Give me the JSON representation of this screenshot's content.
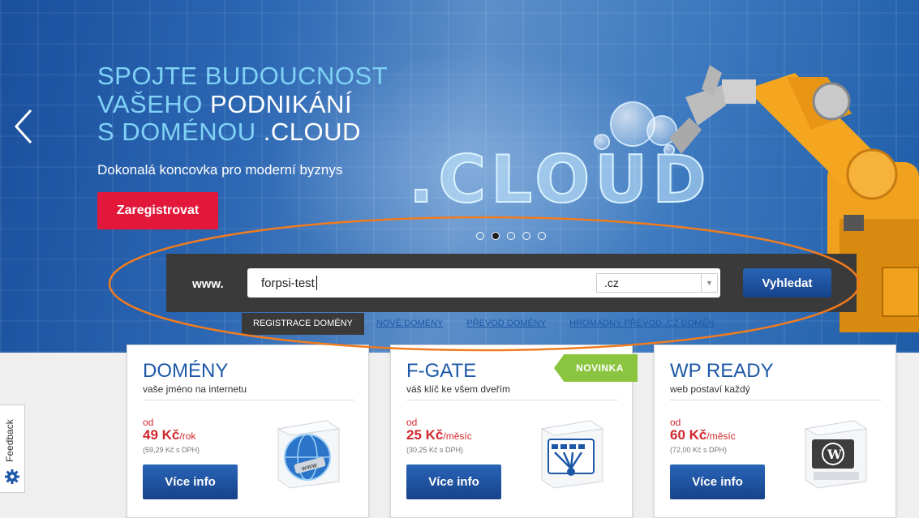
{
  "hero": {
    "headline_line1": "SPOJTE BUDOUCNOST",
    "headline_line2_a": "VAŠEHO ",
    "headline_line2_b": "PODNIKÁNÍ",
    "headline_line3_a": "S DOMÉNOU ",
    "headline_line3_b": ".CLOUD",
    "subtitle": "Dokonalá koncovka pro moderní byznys",
    "register_label": "Zaregistrovat",
    "logo_text": ".CLOUD",
    "slides_total": 5,
    "slide_active": 2
  },
  "search": {
    "prefix": "www.",
    "value": "forpsi-test",
    "tld_selected": ".cz",
    "submit_label": "Vyhledat"
  },
  "tabs": [
    {
      "label": "REGISTRACE DOMÉNY",
      "active": true
    },
    {
      "label": "NOVÉ DOMÉNY",
      "active": false
    },
    {
      "label": "PŘEVOD DOMÉNY",
      "active": false
    },
    {
      "label": "HROMADNÝ PŘEVOD .CZ DOMÉN",
      "active": false
    }
  ],
  "cards": [
    {
      "title": "DOMÉNY",
      "desc": "vaše jméno na internetu",
      "od": "od",
      "price": "49 Kč",
      "period": "/rok",
      "vat": "(59,29 Kč s DPH)",
      "button": "Více info",
      "icon": "www-globe-icon"
    },
    {
      "title": "F-GATE",
      "desc": "váš klíč ke všem dveřím",
      "od": "od",
      "price": "25 Kč",
      "period": "/měsíc",
      "vat": "(30,25 Kč s DPH)",
      "button": "Více info",
      "icon": "gateway-locks-icon",
      "badge": "NOVINKA"
    },
    {
      "title": "WP READY",
      "desc": "web postaví každý",
      "od": "od",
      "price": "60 Kč",
      "period": "/měsíc",
      "vat": "(72,00 Kč s DPH)",
      "button": "Více info",
      "icon": "wordpress-icon"
    }
  ],
  "feedback": {
    "label": "Feedback"
  },
  "colors": {
    "brand_blue": "#1d58a7",
    "register_red": "#e2173a",
    "price_red": "#d0282e",
    "badge_green": "#8bc53f",
    "annotation_orange": "#f07c1f",
    "headline_cyan": "#7fd2f5"
  }
}
